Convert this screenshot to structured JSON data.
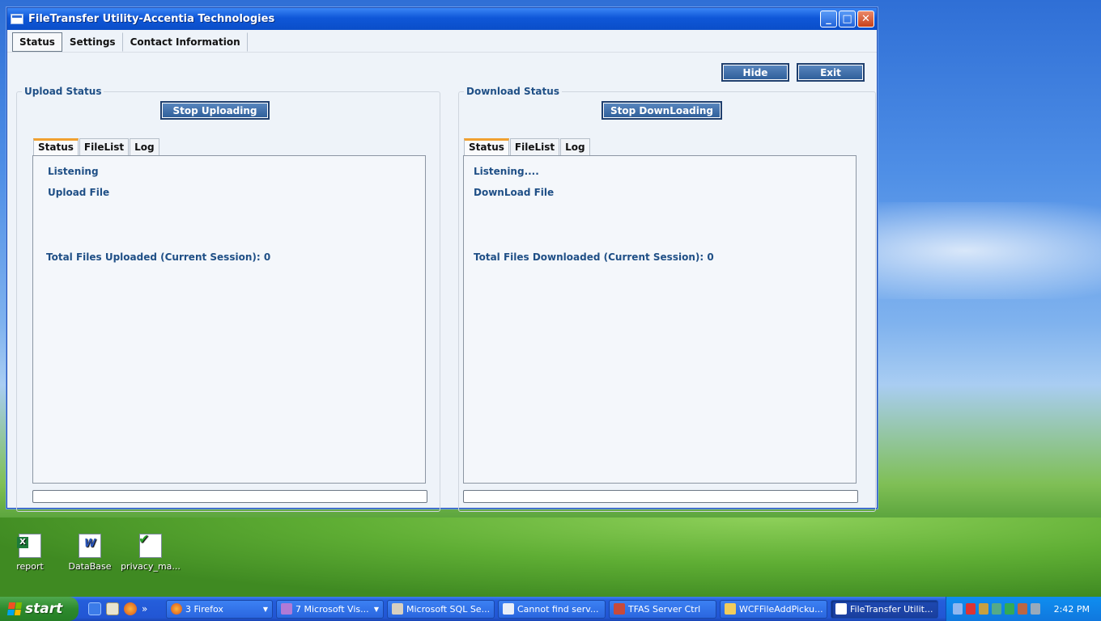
{
  "window": {
    "title": "FileTransfer Utility-Accentia Technologies",
    "controls": {
      "minimize": "_",
      "maximize": "□",
      "close": "✕"
    }
  },
  "top_tabs": [
    "Status",
    "Settings",
    "Contact Information"
  ],
  "actions": {
    "hide": "Hide",
    "exit": "Exit"
  },
  "upload": {
    "group_label": "Upload Status",
    "stop_button": "Stop Uploading",
    "tabs": [
      "Status",
      "FileList",
      "Log"
    ],
    "line1": "Listening",
    "line2": "Upload File",
    "total": "Total Files Uploaded (Current Session): 0"
  },
  "download": {
    "group_label": "Download Status",
    "stop_button": "Stop DownLoading",
    "tabs": [
      "Status",
      "FileList",
      "Log"
    ],
    "line1": "Listening....",
    "line2": "DownLoad File",
    "total": "Total Files Downloaded (Current Session): 0"
  },
  "desktop_icons": [
    {
      "label": "report",
      "icon": "excel-file-icon"
    },
    {
      "label": "DataBase",
      "icon": "word-file-icon"
    },
    {
      "label": "privacy_ma...",
      "icon": "checked-file-icon"
    }
  ],
  "taskbar": {
    "start": "start",
    "tasks": [
      {
        "label": "3 Firefox"
      },
      {
        "label": "7 Microsoft Vis..."
      },
      {
        "label": "Microsoft SQL Se..."
      },
      {
        "label": "Cannot find serv..."
      },
      {
        "label": "TFAS Server Ctrl"
      },
      {
        "label": "WCFFileAddPicku..."
      },
      {
        "label": "FileTransfer Utilit..."
      }
    ],
    "clock": "2:42 PM"
  }
}
